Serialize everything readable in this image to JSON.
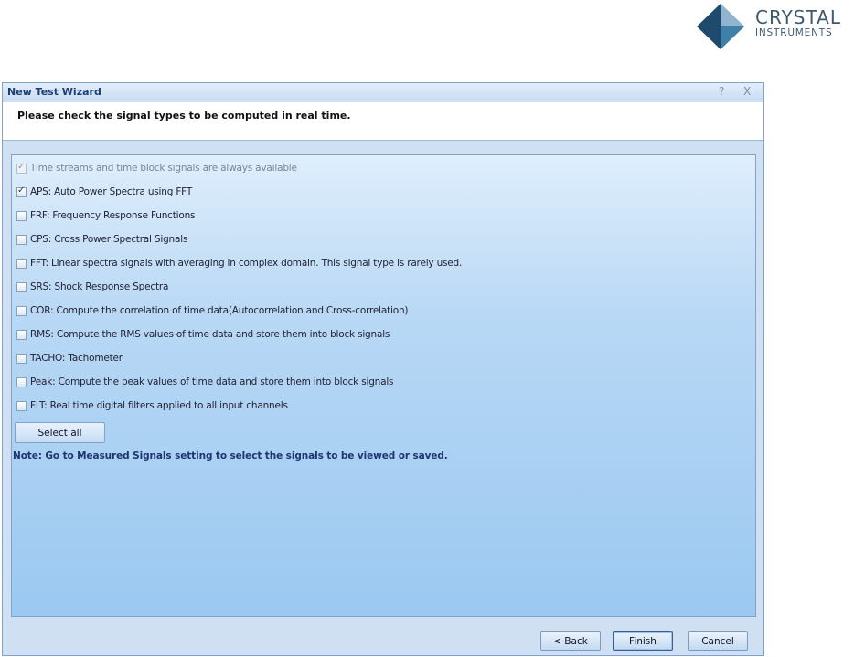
{
  "logo": {
    "line1": "CRYSTAL",
    "line2": "INSTRUMENTS",
    "mark_colors": [
      "#1e4a6e",
      "#3f7fa8",
      "#8fb5cf"
    ]
  },
  "dialog": {
    "title": "New Test Wizard",
    "help_glyph": "?",
    "close_glyph": "X",
    "header": "Please check the signal types to be computed in real time."
  },
  "signals": [
    {
      "label": "Time streams and time block signals are always available",
      "checked": true,
      "disabled": true
    },
    {
      "label": "APS: Auto Power Spectra using FFT",
      "checked": true,
      "disabled": false
    },
    {
      "label": "FRF: Frequency Response Functions",
      "checked": false,
      "disabled": false
    },
    {
      "label": "CPS: Cross Power Spectral Signals",
      "checked": false,
      "disabled": false
    },
    {
      "label": "FFT: Linear spectra signals with averaging in complex domain. This signal type is rarely used.",
      "checked": false,
      "disabled": false
    },
    {
      "label": "SRS: Shock Response Spectra",
      "checked": false,
      "disabled": false
    },
    {
      "label": "COR: Compute the correlation of time data(Autocorrelation and Cross-correlation)",
      "checked": false,
      "disabled": false
    },
    {
      "label": "RMS: Compute the RMS values of time data and store them into block signals",
      "checked": false,
      "disabled": false
    },
    {
      "label": "TACHO: Tachometer",
      "checked": false,
      "disabled": false
    },
    {
      "label": "Peak: Compute the peak values of time data and store them into block signals",
      "checked": false,
      "disabled": false
    },
    {
      "label": "FLT: Real time digital filters applied to all input channels",
      "checked": false,
      "disabled": false
    }
  ],
  "select_all_label": "Select all",
  "note": "Note: Go to Measured Signals setting to select the signals to be viewed or saved.",
  "footer": {
    "back": "< Back",
    "finish": "Finish",
    "cancel": "Cancel"
  }
}
